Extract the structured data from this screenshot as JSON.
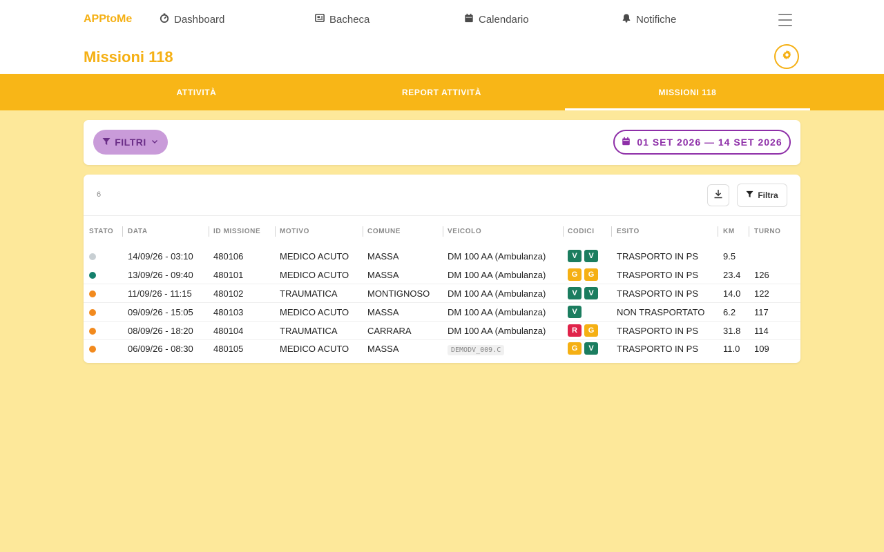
{
  "header": {
    "brand": "APPtoMe",
    "nav": [
      {
        "label": "Dashboard",
        "icon": "gauge-icon"
      },
      {
        "label": "Bacheca",
        "icon": "newspaper-icon"
      },
      {
        "label": "Calendario",
        "icon": "calendar-icon"
      },
      {
        "label": "Notifiche",
        "icon": "bell-icon"
      }
    ],
    "page_title": "Missioni 118"
  },
  "tabs": [
    {
      "label": "ATTIVITÀ",
      "active": false
    },
    {
      "label": "REPORT ATTIVITÀ",
      "active": false
    },
    {
      "label": "MISSIONI 118",
      "active": true
    }
  ],
  "filters": {
    "filtri_label": "FILTRI",
    "date_range": "01 SET 2026 — 14 SET 2026"
  },
  "table": {
    "count": "6",
    "filtra_label": "Filtra",
    "columns": [
      "STATO",
      "DATA",
      "ID MISSIONE",
      "MOTIVO",
      "COMUNE",
      "VEICOLO",
      "CODICI",
      "ESITO",
      "KM",
      "TURNO"
    ],
    "rows": [
      {
        "status": "grey",
        "data": "14/09/26 - 03:10",
        "id": "480106",
        "motivo": "MEDICO ACUTO",
        "comune": "MASSA",
        "veicolo": "DM 100 AA (Ambulanza)",
        "veicolo_chip": false,
        "codici": [
          "V",
          "V"
        ],
        "esito": "TRASPORTO IN PS",
        "km": "9.5",
        "turno": ""
      },
      {
        "status": "teal",
        "data": "13/09/26 - 09:40",
        "id": "480101",
        "motivo": "MEDICO ACUTO",
        "comune": "MASSA",
        "veicolo": "DM 100 AA (Ambulanza)",
        "veicolo_chip": false,
        "codici": [
          "G",
          "G"
        ],
        "esito": "TRASPORTO IN PS",
        "km": "23.4",
        "turno": "126"
      },
      {
        "status": "orange",
        "data": "11/09/26 - 11:15",
        "id": "480102",
        "motivo": "TRAUMATICA",
        "comune": "MONTIGNOSO",
        "veicolo": "DM 100 AA (Ambulanza)",
        "veicolo_chip": false,
        "codici": [
          "V",
          "V"
        ],
        "esito": "TRASPORTO IN PS",
        "km": "14.0",
        "turno": "122"
      },
      {
        "status": "orange",
        "data": "09/09/26 - 15:05",
        "id": "480103",
        "motivo": "MEDICO ACUTO",
        "comune": "MASSA",
        "veicolo": "DM 100 AA (Ambulanza)",
        "veicolo_chip": false,
        "codici": [
          "V"
        ],
        "esito": "NON TRASPORTATO",
        "km": "6.2",
        "turno": "117"
      },
      {
        "status": "orange",
        "data": "08/09/26 - 18:20",
        "id": "480104",
        "motivo": "TRAUMATICA",
        "comune": "CARRARA",
        "veicolo": "DM 100 AA (Ambulanza)",
        "veicolo_chip": false,
        "codici": [
          "R",
          "G"
        ],
        "esito": "TRASPORTO IN PS",
        "km": "31.8",
        "turno": "114"
      },
      {
        "status": "orange",
        "data": "06/09/26 - 08:30",
        "id": "480105",
        "motivo": "MEDICO ACUTO",
        "comune": "MASSA",
        "veicolo": "DEMODV_009.C",
        "veicolo_chip": true,
        "codici": [
          "G",
          "V"
        ],
        "esito": "TRASPORTO IN PS",
        "km": "11.0",
        "turno": "109"
      }
    ]
  },
  "colors": {
    "accent": "#f5b014",
    "tabbar": "#f8b617",
    "background": "#fde89a",
    "filter_purple": "#8e2fa8",
    "status_grey": "#c8cfd3",
    "status_teal": "#14806c",
    "status_orange": "#f28a1e",
    "code_V": "#1b7d5f",
    "code_G": "#f5b014",
    "code_R": "#e0234a"
  }
}
